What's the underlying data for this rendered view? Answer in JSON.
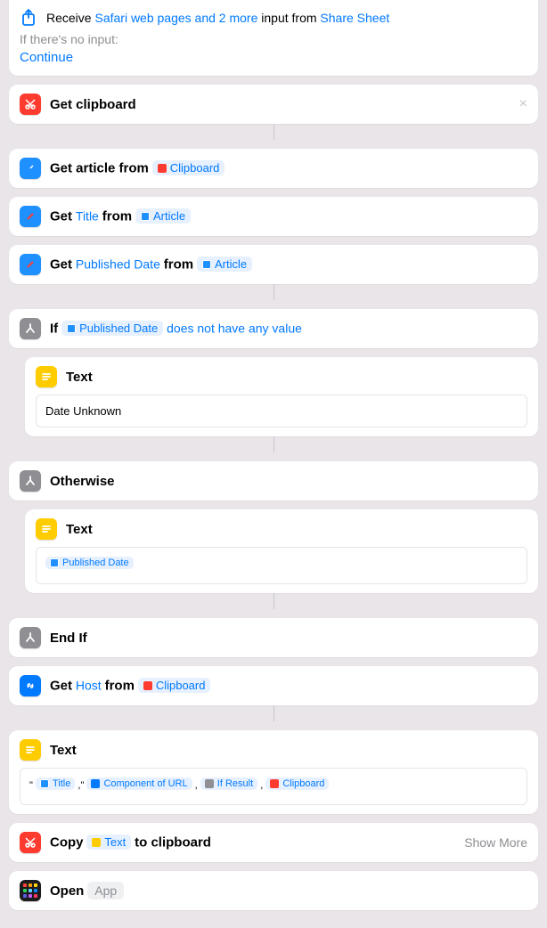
{
  "header": {
    "receive": "Receive",
    "input_types": "Safari web pages and 2 more",
    "input_from": "input from",
    "share_sheet": "Share Sheet",
    "no_input": "If there's no input:",
    "continue": "Continue"
  },
  "actions": {
    "get_clipboard": {
      "title": "Get clipboard"
    },
    "get_article": {
      "prefix": "Get article from",
      "clipboard": "Clipboard"
    },
    "get_title": {
      "get": "Get",
      "title": "Title",
      "from": "from",
      "article": "Article"
    },
    "get_pubdate": {
      "get": "Get",
      "pubdate": "Published Date",
      "from": "from",
      "article": "Article"
    },
    "if_block": {
      "if": "If",
      "pubdate": "Published Date",
      "cond": "does not have any value"
    },
    "text1": {
      "label": "Text",
      "value": "Date Unknown"
    },
    "otherwise": {
      "label": "Otherwise"
    },
    "text2": {
      "label": "Text",
      "pubdate": "Published Date"
    },
    "endif": {
      "label": "End If"
    },
    "get_host": {
      "get": "Get",
      "host": "Host",
      "from": "from",
      "clipboard": "Clipboard"
    },
    "text3": {
      "label": "Text",
      "q1": "\"",
      "title": "Title",
      "q2": ",\"",
      "comp": "Component of URL",
      "sep1": ",",
      "ifres": "If Result",
      "sep2": ",",
      "clip": "Clipboard"
    },
    "copy": {
      "copy": "Copy",
      "text": "Text",
      "toclip": "to clipboard",
      "showmore": "Show More"
    },
    "open": {
      "open": "Open",
      "app": "App"
    }
  }
}
